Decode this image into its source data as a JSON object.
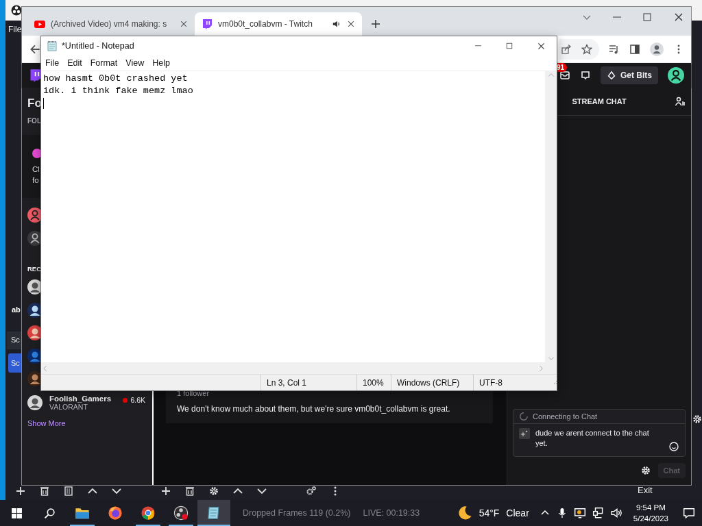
{
  "obs": {
    "menu": "File",
    "panel_label": "ab",
    "section_title": "Sc",
    "scene_button": "Sc",
    "exit": "Exit"
  },
  "browser": {
    "tabs": [
      {
        "title": "(Archived Video) vm4 making: s",
        "kind": "video",
        "selected": false,
        "audio": false
      },
      {
        "title": "vm0b0t_collabvm - Twitch",
        "kind": "twitch",
        "selected": true,
        "audio": true
      }
    ]
  },
  "twitch": {
    "notification_count": "91",
    "get_bits": "Get Bits",
    "sidebar": {
      "heading": "Fo",
      "section": "FOL",
      "promo_lines": [
        "Cl",
        "fo"
      ],
      "recommended_heading": "REC",
      "channels": [
        {
          "name": "Foolish_Gamers",
          "game": "VALORANT",
          "viewers": "6.6K",
          "live": true
        }
      ],
      "show_more": "Show More"
    },
    "about": {
      "followers": "1 follower",
      "bio": "We don't know much about them, but we're sure vm0b0t_collabvm is great."
    },
    "chat": {
      "header": "STREAM CHAT",
      "status": "Connecting to Chat",
      "input_value": "dude we arent connect to the chat yet.",
      "send": "Chat",
      "send_disabled": true
    }
  },
  "notepad": {
    "title": "*Untitled - Notepad",
    "menu": [
      "File",
      "Edit",
      "Format",
      "View",
      "Help"
    ],
    "lines": [
      "how hasmt 0b0t crashed yet",
      "idk. i think fake memz lmao"
    ],
    "status": {
      "position": "Ln 3, Col 1",
      "zoom": "100%",
      "line_endings": "Windows (CRLF)",
      "encoding": "UTF-8"
    }
  },
  "taskbar": {
    "apps": [
      {
        "kind": "explorer",
        "running": true,
        "selected": false
      },
      {
        "kind": "firefox",
        "running": false,
        "selected": false
      },
      {
        "kind": "chrome",
        "running": true,
        "selected": false
      },
      {
        "kind": "obs",
        "running": true,
        "selected": false
      },
      {
        "kind": "notepad",
        "running": true,
        "selected": true
      }
    ],
    "obs_status": [
      "Dropped Frames 119 (0.2%)",
      "LIVE: 00:19:33"
    ],
    "weather": {
      "temperature": "54°F",
      "condition": "Clear"
    },
    "time": "9:54 PM",
    "date": "5/24/2023"
  }
}
